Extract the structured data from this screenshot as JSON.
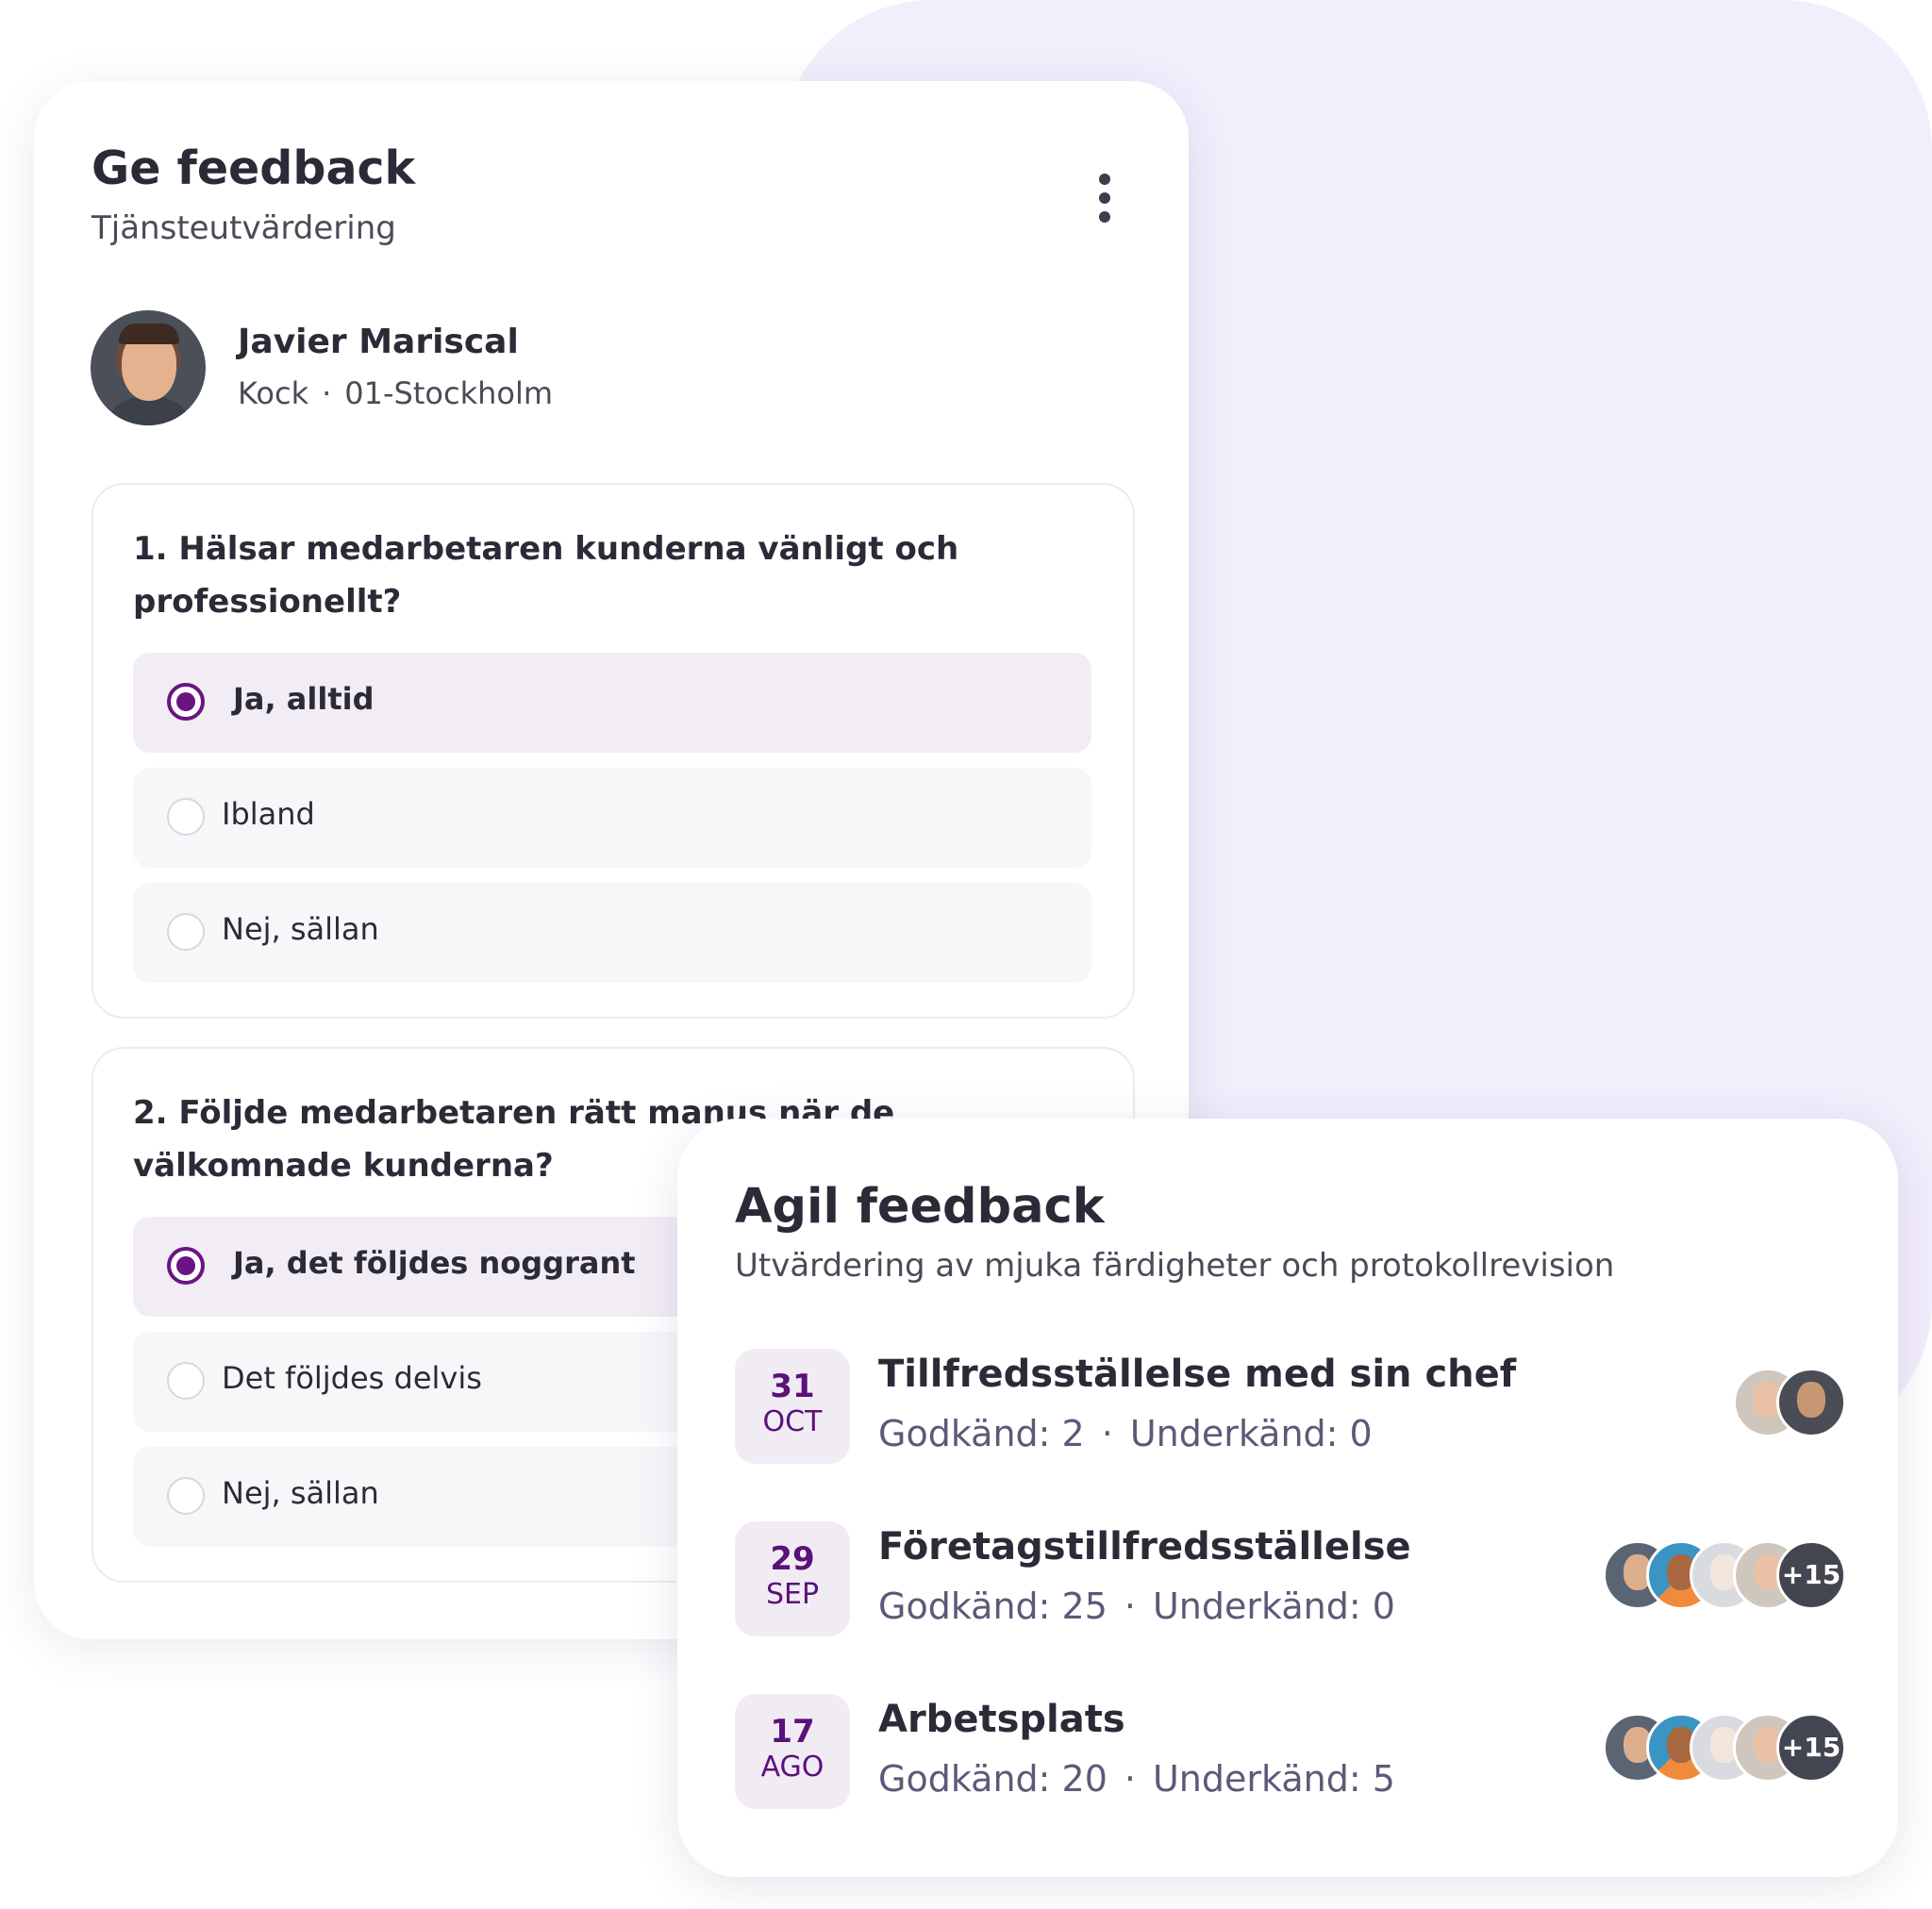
{
  "feedback_card": {
    "title": "Ge feedback",
    "subtitle": "Tjänsteutvärdering",
    "person": {
      "name": "Javier Mariscal",
      "role": "Kock",
      "separator": "·",
      "location": "01-Stockholm"
    },
    "questions": [
      {
        "text": "1. Hälsar medarbetaren kunderna vänligt och professionellt?",
        "options": [
          {
            "label": "Ja, alltid",
            "selected": true
          },
          {
            "label": "Ibland",
            "selected": false
          },
          {
            "label": "Nej, sällan",
            "selected": false
          }
        ]
      },
      {
        "text": "2. Följde medarbetaren rätt manus när de välkomnade kunderna?",
        "options": [
          {
            "label": "Ja, det följdes noggrant",
            "selected": true
          },
          {
            "label": "Det följdes delvis",
            "selected": false
          },
          {
            "label": "Nej, sällan",
            "selected": false
          }
        ]
      }
    ]
  },
  "agil_card": {
    "title": "Agil feedback",
    "subtitle": "Utvärdering av mjuka färdigheter och protokollrevision",
    "separator": "·",
    "items": [
      {
        "day": "31",
        "month": "OCT",
        "title": "Tillfredsställelse med sin chef",
        "approved": "Godkänd: 2",
        "failed": "Underkänd: 0",
        "extra_count": ""
      },
      {
        "day": "29",
        "month": "SEP",
        "title": "Företagstillfredsställelse",
        "approved": "Godkänd: 25",
        "failed": "Underkänd: 0",
        "extra_count": "+15"
      },
      {
        "day": "17",
        "month": "AGO",
        "title": "Arbetsplats",
        "approved": "Godkänd: 20",
        "failed": "Underkänd: 5",
        "extra_count": "+15"
      }
    ]
  },
  "colors": {
    "accent": "#6a1483",
    "background_blob": "#f2eefc",
    "selected_option": "#f2edf5",
    "date_badge": "#f1ecf4"
  }
}
